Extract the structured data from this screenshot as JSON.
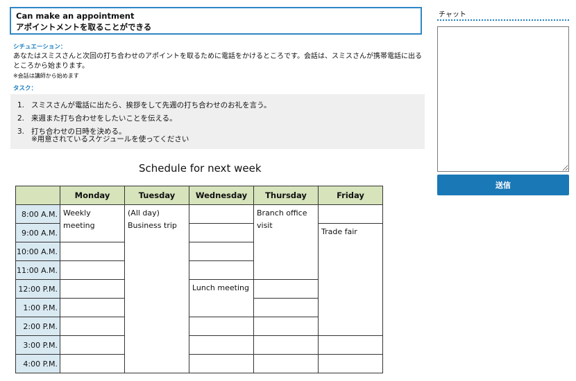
{
  "header": {
    "title_en": "Can make an appointment",
    "title_ja": "アポイントメントを取ることができる"
  },
  "situation": {
    "label": "シチュエーション：",
    "text": "あなたはスミスさんと次回の打ち合わせのアポイントを取るために電話をかけるところです。会話は、スミスさんが携帯電話に出るところから始まります。",
    "note": "※会話は講師から始めます"
  },
  "task": {
    "label": "タスク：",
    "items": [
      {
        "num": "1.",
        "text": "スミスさんが電話に出たら、挨拶をして先週の打ち合わせのお礼を言う。"
      },
      {
        "num": "2.",
        "text": "来週また打ち合わせをしたいことを伝える。"
      },
      {
        "num": "3.",
        "text": "打ち合わせの日時を決める。"
      }
    ],
    "sub": "※用意されているスケジュールを使ってください"
  },
  "schedule": {
    "title": "Schedule for next week",
    "days": [
      "Monday",
      "Tuesday",
      "Wednesday",
      "Thursday",
      "Friday"
    ],
    "times": [
      "8:00 A.M.",
      "9:00 A.M.",
      "10:00 A.M.",
      "11:00 A.M.",
      "12:00 P.M.",
      "1:00 P.M.",
      "2:00 P.M.",
      "3:00 P.M.",
      "4:00 P.M."
    ],
    "events": {
      "monday_weekly": "Weekly meeting",
      "tuesday_allday": "(All day)",
      "tuesday_trip": "Business trip",
      "wednesday_lunch": "Lunch meeting",
      "thursday_branch": "Branch office visit",
      "friday_trade": "Trade fair"
    }
  },
  "chat": {
    "label": "チャット",
    "send_label": "送信"
  }
}
